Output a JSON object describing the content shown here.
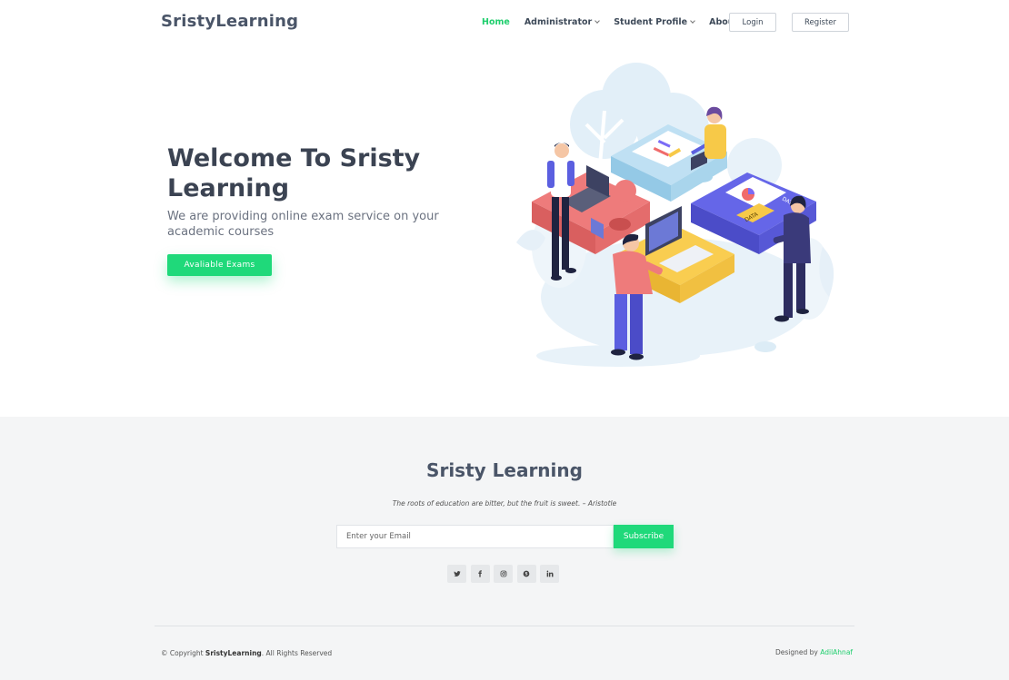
{
  "nav": {
    "brand": "SristyLearning",
    "items": [
      {
        "label": "Home",
        "active": true,
        "dropdown": false
      },
      {
        "label": "Administrator",
        "active": false,
        "dropdown": true
      },
      {
        "label": "Student Profile",
        "active": false,
        "dropdown": true
      },
      {
        "label": "About",
        "active": false,
        "dropdown": false
      }
    ],
    "login_label": "Login",
    "register_label": "Register"
  },
  "hero": {
    "title": "Welcome To Sristy Learning",
    "subtitle": "We are providing online exam service on your academic courses",
    "cta_label": "Avaliable Exams",
    "illustration_icon": "team-puzzle-illustration",
    "illustration_labels": [
      "DATA",
      "DATA"
    ]
  },
  "footer": {
    "title": "Sristy Learning",
    "quote": "The roots of education are bitter, but the fruit is sweet. – Aristotle",
    "email_placeholder": "Enter your Email",
    "subscribe_label": "Subscribe",
    "socials": [
      "twitter-icon",
      "facebook-icon",
      "instagram-icon",
      "skype-icon",
      "linkedin-icon"
    ],
    "copyright_prefix": "© Copyright ",
    "copyright_brand": "SristyLearning",
    "copyright_suffix": ". All Rights Reserved",
    "designed_prefix": "Designed by ",
    "designer": "AdilAhnaf"
  },
  "colors": {
    "accent": "#1fd97a",
    "active_link": "#1fce6d",
    "footer_bg": "#f4f5f6",
    "heading": "#3b4352"
  }
}
